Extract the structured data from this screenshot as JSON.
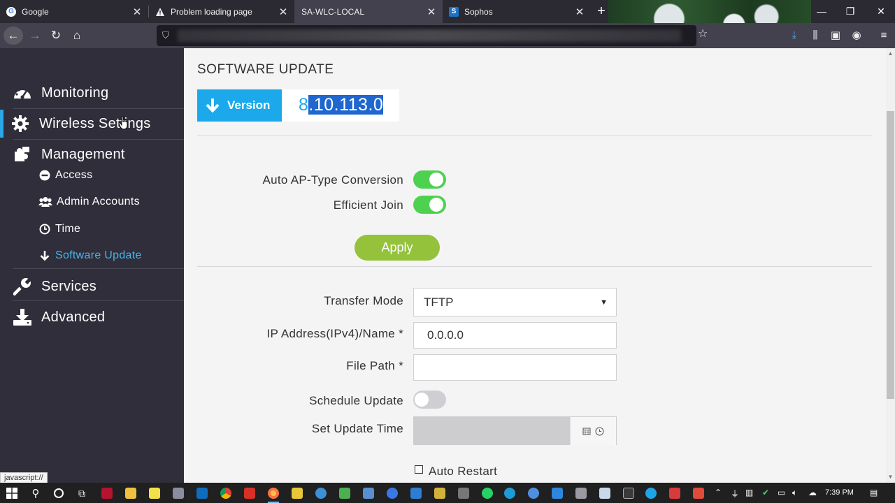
{
  "browser": {
    "tabs": [
      {
        "title": "Google",
        "favicon": "google-icon"
      },
      {
        "title": "Problem loading page",
        "favicon": "warning-icon"
      },
      {
        "title": "SA-WLC-LOCAL",
        "favicon": ""
      },
      {
        "title": "Sophos",
        "favicon": "sophos-icon"
      }
    ],
    "active_tab_index": 2,
    "close_glyph": "✕"
  },
  "sidebar": {
    "items": [
      {
        "label": "Monitoring",
        "icon": "dashboard-icon"
      },
      {
        "label": "Wireless Settings",
        "icon": "gear-icon"
      },
      {
        "label": "Management",
        "icon": "puzzle-icon"
      },
      {
        "label": "Services",
        "icon": "wrench-icon"
      },
      {
        "label": "Advanced",
        "icon": "download-tray-icon"
      }
    ],
    "management_children": [
      {
        "label": "Access",
        "icon": "minus-circle-icon"
      },
      {
        "label": "Admin Accounts",
        "icon": "users-icon"
      },
      {
        "label": "Time",
        "icon": "clock-icon"
      },
      {
        "label": "Software Update",
        "icon": "arrow-down-icon"
      }
    ],
    "active_item": "Wireless Settings",
    "active_child": "Software Update"
  },
  "main": {
    "title": "SOFTWARE UPDATE",
    "version": {
      "label": "Version",
      "value_prefix": "8",
      "value_selected": ".10.113.0"
    },
    "auto_ap_type_conversion": {
      "label": "Auto AP-Type Conversion",
      "on": true
    },
    "efficient_join": {
      "label": "Efficient Join",
      "on": true
    },
    "apply_label": "Apply",
    "transfer_mode": {
      "label": "Transfer Mode",
      "value": "TFTP"
    },
    "ip_address": {
      "label": "IP Address(IPv4)/Name *",
      "value": "0.0.0.0"
    },
    "file_path": {
      "label": "File Path *",
      "value": ""
    },
    "schedule_update": {
      "label": "Schedule Update",
      "on": false
    },
    "set_update_time": {
      "label": "Set Update Time",
      "value": ""
    },
    "auto_restart": {
      "label": "Auto Restart",
      "checked": false
    }
  },
  "status_bar": {
    "text": "javascript://"
  },
  "taskbar": {
    "time": "7:39 PM"
  },
  "colors": {
    "accent": "#1ba9ec",
    "toggle_on": "#4dd14f",
    "apply": "#94c23b",
    "sidebar_bg": "#2f2e3a",
    "active_link": "#4ab4ea"
  }
}
